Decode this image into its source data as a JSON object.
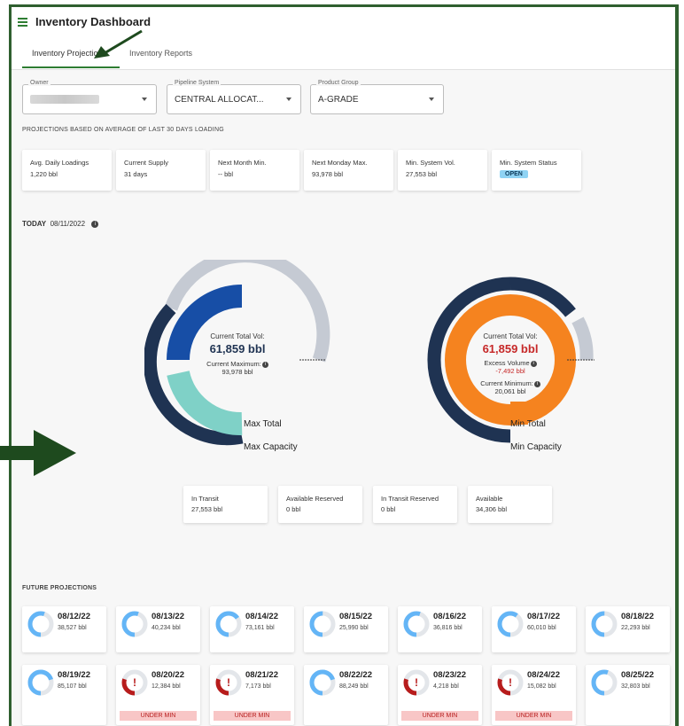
{
  "app": {
    "title": "Inventory Dashboard"
  },
  "tabs": [
    {
      "label": "Inventory Projections",
      "active": true
    },
    {
      "label": "Inventory Reports",
      "active": false
    }
  ],
  "filters": {
    "owner": {
      "label": "Owner",
      "value": ""
    },
    "pipeline": {
      "label": "Pipeline System",
      "value": "CENTRAL ALLOCAT..."
    },
    "product": {
      "label": "Product Group",
      "value": "A-GRADE"
    }
  },
  "projections": {
    "heading": "PROJECTIONS BASED ON AVERAGE OF LAST 30 DAYS LOADING",
    "cards": [
      {
        "title": "Avg. Daily Loadings",
        "value": "1,220 bbl"
      },
      {
        "title": "Current Supply",
        "value": "31 days"
      },
      {
        "title": "Next Month Min.",
        "value": "-- bbl"
      },
      {
        "title": "Next Monday Max.",
        "value": "93,978 bbl"
      },
      {
        "title": "Min. System Vol.",
        "value": "27,553 bbl"
      },
      {
        "title": "Min. System Status",
        "value": "OPEN"
      }
    ]
  },
  "today": {
    "label": "TODAY",
    "date": "08/11/2022"
  },
  "gauge_max": {
    "current_label": "Current Total Vol:",
    "current_value": "61,859 bbl",
    "secondary_label": "Current Maximum:",
    "secondary_value": "93,978 bbl",
    "label_total": "Max Total",
    "label_capacity": "Max Capacity"
  },
  "gauge_min": {
    "current_label": "Current Total Vol:",
    "current_value": "61,859 bbl",
    "excess_label": "Excess Volume",
    "excess_value": "-7,492 bbl",
    "min_label": "Current Minimum:",
    "min_value": "20,061 bbl",
    "label_total": "Min Total",
    "label_capacity": "Min Capacity"
  },
  "stats": [
    {
      "title": "In Transit",
      "value": "27,553 bbl"
    },
    {
      "title": "Available Reserved",
      "value": "0 bbl"
    },
    {
      "title": "In Transit Reserved",
      "value": "0 bbl"
    },
    {
      "title": "Available",
      "value": "34,306 bbl"
    }
  ],
  "future": {
    "heading": "FUTURE PROJECTIONS",
    "under_label": "UNDER MIN",
    "items": [
      {
        "date": "08/12/22",
        "volume": "38,527 bbl",
        "fill": 0.55,
        "under_min": false
      },
      {
        "date": "08/13/22",
        "volume": "40,234 bbl",
        "fill": 0.55,
        "under_min": false
      },
      {
        "date": "08/14/22",
        "volume": "73,161 bbl",
        "fill": 0.65,
        "under_min": false
      },
      {
        "date": "08/15/22",
        "volume": "25,990 bbl",
        "fill": 0.5,
        "under_min": false
      },
      {
        "date": "08/16/22",
        "volume": "36,816 bbl",
        "fill": 0.55,
        "under_min": false
      },
      {
        "date": "08/17/22",
        "volume": "60,010 bbl",
        "fill": 0.6,
        "under_min": false
      },
      {
        "date": "08/18/22",
        "volume": "22,293 bbl",
        "fill": 0.5,
        "under_min": false
      },
      {
        "date": "08/19/22",
        "volume": "85,107 bbl",
        "fill": 0.7,
        "under_min": false
      },
      {
        "date": "08/20/22",
        "volume": "12,384 bbl",
        "fill": 0.3,
        "under_min": true
      },
      {
        "date": "08/21/22",
        "volume": "7,173 bbl",
        "fill": 0.3,
        "under_min": true
      },
      {
        "date": "08/22/22",
        "volume": "88,249 bbl",
        "fill": 0.7,
        "under_min": false
      },
      {
        "date": "08/23/22",
        "volume": "4,218 bbl",
        "fill": 0.3,
        "under_min": true
      },
      {
        "date": "08/24/22",
        "volume": "15,082 bbl",
        "fill": 0.3,
        "under_min": true
      },
      {
        "date": "08/25/22",
        "volume": "32,803 bbl",
        "fill": 0.55,
        "under_min": false
      }
    ]
  }
}
